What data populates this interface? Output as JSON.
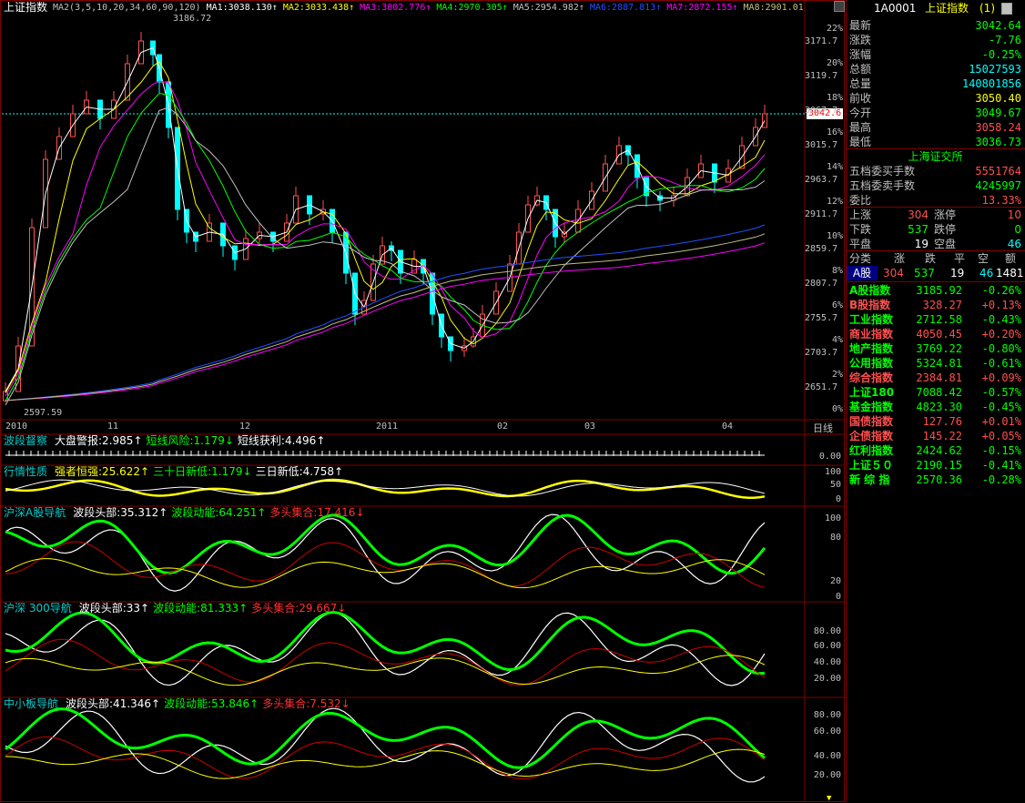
{
  "main": {
    "title": "上证指数",
    "ma_legend": [
      {
        "text": "MA2(3,5,10,20,34,60,90,120)",
        "color": "#c0c0c0"
      },
      {
        "text": "MA1:3038.130↑",
        "color": "#ffffff"
      },
      {
        "text": "MA2:3033.438↑",
        "color": "#ffff00"
      },
      {
        "text": "MA3:3002.776↑",
        "color": "#ff00ff"
      },
      {
        "text": "MA4:2970.305↑",
        "color": "#00ff00"
      },
      {
        "text": "MA5:2954.982↑",
        "color": "#c0c0c0"
      },
      {
        "text": "MA6:2887.813↑",
        "color": "#2050ff"
      },
      {
        "text": "MA7:2872.155↑",
        "color": "#ff00ff"
      },
      {
        "text": "MA8:2901.01",
        "color": "#c0c080"
      }
    ],
    "high_marker": "3186.72",
    "low_marker": "2597.59",
    "current_price_tag": "3042.6",
    "price_axis": [
      "3171.7",
      "3119.7",
      "3067.7",
      "3015.7",
      "2963.7",
      "2911.7",
      "2859.7",
      "2807.7",
      "2755.7",
      "2703.7",
      "2651.7"
    ],
    "pct_axis": [
      "22%",
      "20%",
      "18%",
      "16%",
      "14%",
      "12%",
      "10%",
      "8%",
      "6%",
      "4%",
      "2%",
      "0%"
    ],
    "date_axis": [
      "2010",
      "11",
      "12",
      "2011",
      "02",
      "03",
      "04"
    ],
    "period": "日线"
  },
  "indicators": [
    {
      "name": "波段督察",
      "items": [
        {
          "t": "大盘警报:2.985↑",
          "c": "#ffffff"
        },
        {
          "t": "短线风险:1.179↓",
          "c": "#00ff00"
        },
        {
          "t": "短线获利:4.496↑",
          "c": "#ffffff"
        }
      ],
      "axis": [
        "0.00"
      ]
    },
    {
      "name": "行情性质",
      "items": [
        {
          "t": "强者恒强:25.622↑",
          "c": "#ffff00"
        },
        {
          "t": "三十日新低:1.179↓",
          "c": "#00ff00"
        },
        {
          "t": "三日新低:4.758↑",
          "c": "#ffffff"
        }
      ],
      "axis": [
        "100",
        "50",
        "0"
      ]
    },
    {
      "name": "沪深A股导航",
      "items": [
        {
          "t": "波段头部:35.312↑",
          "c": "#ffffff"
        },
        {
          "t": "波段动能:64.251↑",
          "c": "#00ff00"
        },
        {
          "t": "多头集合:17.416↓",
          "c": "#ff3030"
        }
      ],
      "axis": [
        "100",
        "80",
        "20",
        "0"
      ]
    },
    {
      "name": "沪深 300导航",
      "items": [
        {
          "t": "波段头部:33↑",
          "c": "#ffffff"
        },
        {
          "t": "波段动能:81.333↑",
          "c": "#00ff00"
        },
        {
          "t": "多头集合:29.667↓",
          "c": "#ff3030"
        }
      ],
      "axis": [
        "80.00",
        "60.00",
        "40.00",
        "20.00"
      ]
    },
    {
      "name": "中小板导航",
      "items": [
        {
          "t": "波段头部:41.346↑",
          "c": "#ffffff"
        },
        {
          "t": "波段动能:53.846↑",
          "c": "#00ff00"
        },
        {
          "t": "多头集合:7.532↓",
          "c": "#ff3030"
        }
      ],
      "axis": [
        "80.00",
        "60.00",
        "40.00",
        "20.00"
      ]
    }
  ],
  "panel": {
    "code": "1A0001",
    "name": "上证指数",
    "suffix": "(1)",
    "quotes": [
      {
        "label": "最新",
        "value": "3042.64",
        "color": "#00ff00"
      },
      {
        "label": "涨跌",
        "value": "-7.76",
        "color": "#00ff00"
      },
      {
        "label": "涨幅",
        "value": "-0.25%",
        "color": "#00ff00"
      },
      {
        "label": "总额",
        "value": "15027593",
        "color": "#00ffff"
      },
      {
        "label": "总量",
        "value": "140801856",
        "color": "#00ffff"
      },
      {
        "label": "前收",
        "value": "3050.40",
        "color": "#ffff00"
      },
      {
        "label": "今开",
        "value": "3049.67",
        "color": "#00ff00"
      },
      {
        "label": "最高",
        "value": "3058.24",
        "color": "#ff5050"
      },
      {
        "label": "最低",
        "value": "3036.73",
        "color": "#00ff00"
      }
    ],
    "exchange": "上海证交所",
    "orders": [
      {
        "label": "五档委买手数",
        "value": "5551764",
        "color": "#ff5050"
      },
      {
        "label": "五档委卖手数",
        "value": "4245997",
        "color": "#00ff00"
      },
      {
        "label": "委比",
        "value": "13.33%",
        "color": "#ff5050"
      }
    ],
    "breadth": [
      {
        "l1": "上涨",
        "v1": "304",
        "c1": "#ff5050",
        "l2": "涨停",
        "v2": "10",
        "c2": "#ff5050"
      },
      {
        "l1": "下跌",
        "v1": "537",
        "c1": "#00ff00",
        "l2": "跌停",
        "v2": "0",
        "c2": "#00ff00"
      },
      {
        "l1": "平盘",
        "v1": "19",
        "c1": "#ffffff",
        "l2": "空盘",
        "v2": "46",
        "c2": "#00ffff"
      }
    ],
    "table_headers": [
      "分类",
      "涨",
      "跌",
      "平",
      "空",
      "额"
    ],
    "a_share": {
      "label": "A股",
      "up": "304",
      "down": "537",
      "flat": "19",
      "empty": "46",
      "amount": "1481"
    },
    "indices": [
      {
        "name": "A股指数",
        "value": "3185.92",
        "chg": "-0.26%",
        "up": false
      },
      {
        "name": "B股指数",
        "value": "328.27",
        "chg": "+0.13%",
        "up": true
      },
      {
        "name": "工业指数",
        "value": "2712.58",
        "chg": "-0.43%",
        "up": false
      },
      {
        "name": "商业指数",
        "value": "4050.45",
        "chg": "+0.20%",
        "up": true
      },
      {
        "name": "地产指数",
        "value": "3769.22",
        "chg": "-0.80%",
        "up": false
      },
      {
        "name": "公用指数",
        "value": "5324.81",
        "chg": "-0.61%",
        "up": false
      },
      {
        "name": "综合指数",
        "value": "2384.81",
        "chg": "+0.09%",
        "up": true
      },
      {
        "name": "上证180",
        "value": "7088.42",
        "chg": "-0.57%",
        "up": false
      },
      {
        "name": "基金指数",
        "value": "4823.30",
        "chg": "-0.45%",
        "up": false
      },
      {
        "name": "国债指数",
        "value": "127.76",
        "chg": "+0.01%",
        "up": true
      },
      {
        "name": "企债指数",
        "value": "145.22",
        "chg": "+0.05%",
        "up": true
      },
      {
        "name": "红利指数",
        "value": "2424.62",
        "chg": "-0.15%",
        "up": false
      },
      {
        "name": "上证５０",
        "value": "2190.15",
        "chg": "-0.41%",
        "up": false
      },
      {
        "name": "新 综 指",
        "value": "2570.36",
        "chg": "-0.28%",
        "up": false
      }
    ]
  },
  "colors": {
    "up": "#ff5050",
    "down": "#00ffff",
    "frame": "#800000",
    "grid": "#333333"
  }
}
